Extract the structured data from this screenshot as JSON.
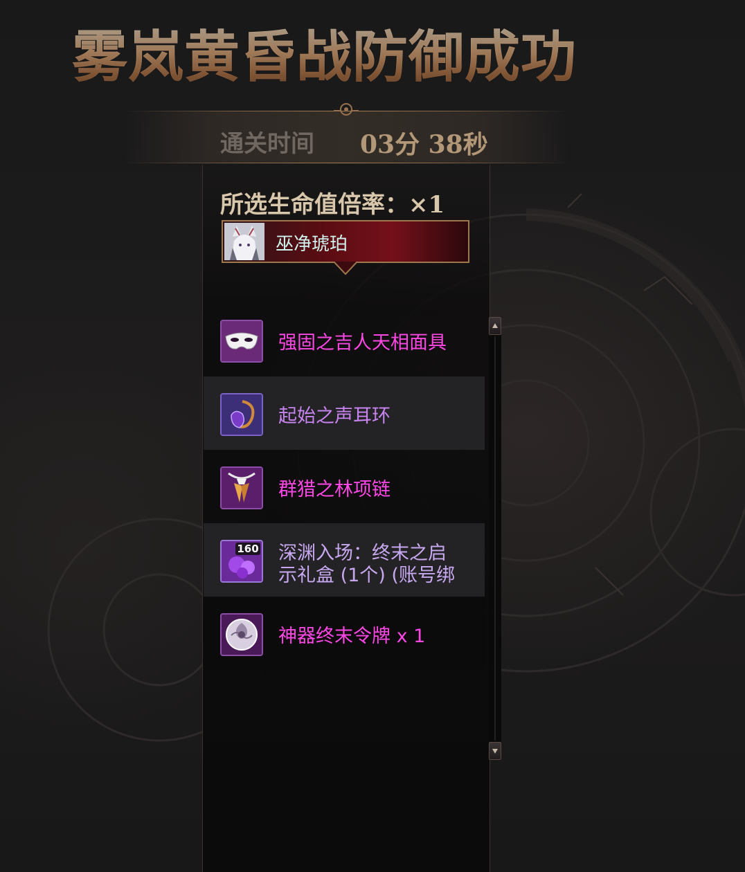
{
  "title": "雾岚黄昏战防御成功",
  "clear_time": {
    "label": "通关时间",
    "value": "03分 38秒"
  },
  "hp_multiplier": {
    "label": "所选生命值倍率：×1"
  },
  "character": {
    "name": "巫净琥珀"
  },
  "rewards": [
    {
      "icon": "mask-icon",
      "lines": [
        "强固之吉人天相面具"
      ],
      "color": "#ff47e6"
    },
    {
      "icon": "earring-icon",
      "lines": [
        "起始之声耳环"
      ],
      "color": "#c884f0"
    },
    {
      "icon": "necklace-icon",
      "lines": [
        "群猎之林项链"
      ],
      "color": "#ff47e6"
    },
    {
      "icon": "gift-box-icon",
      "badge": "160",
      "lines": [
        "深渊入场：终末之启",
        "示礼盒 (1个) (账号绑"
      ],
      "color": "#c8a8f0"
    },
    {
      "icon": "token-icon",
      "lines": [
        "神器终末令牌 x 1"
      ],
      "color": "#ff47e6"
    }
  ],
  "colors": {
    "title_gold": "#e3ad7d",
    "epic_pink": "#ff47e6",
    "rare_purple": "#c884f0",
    "char_name": "#cff4f0"
  }
}
